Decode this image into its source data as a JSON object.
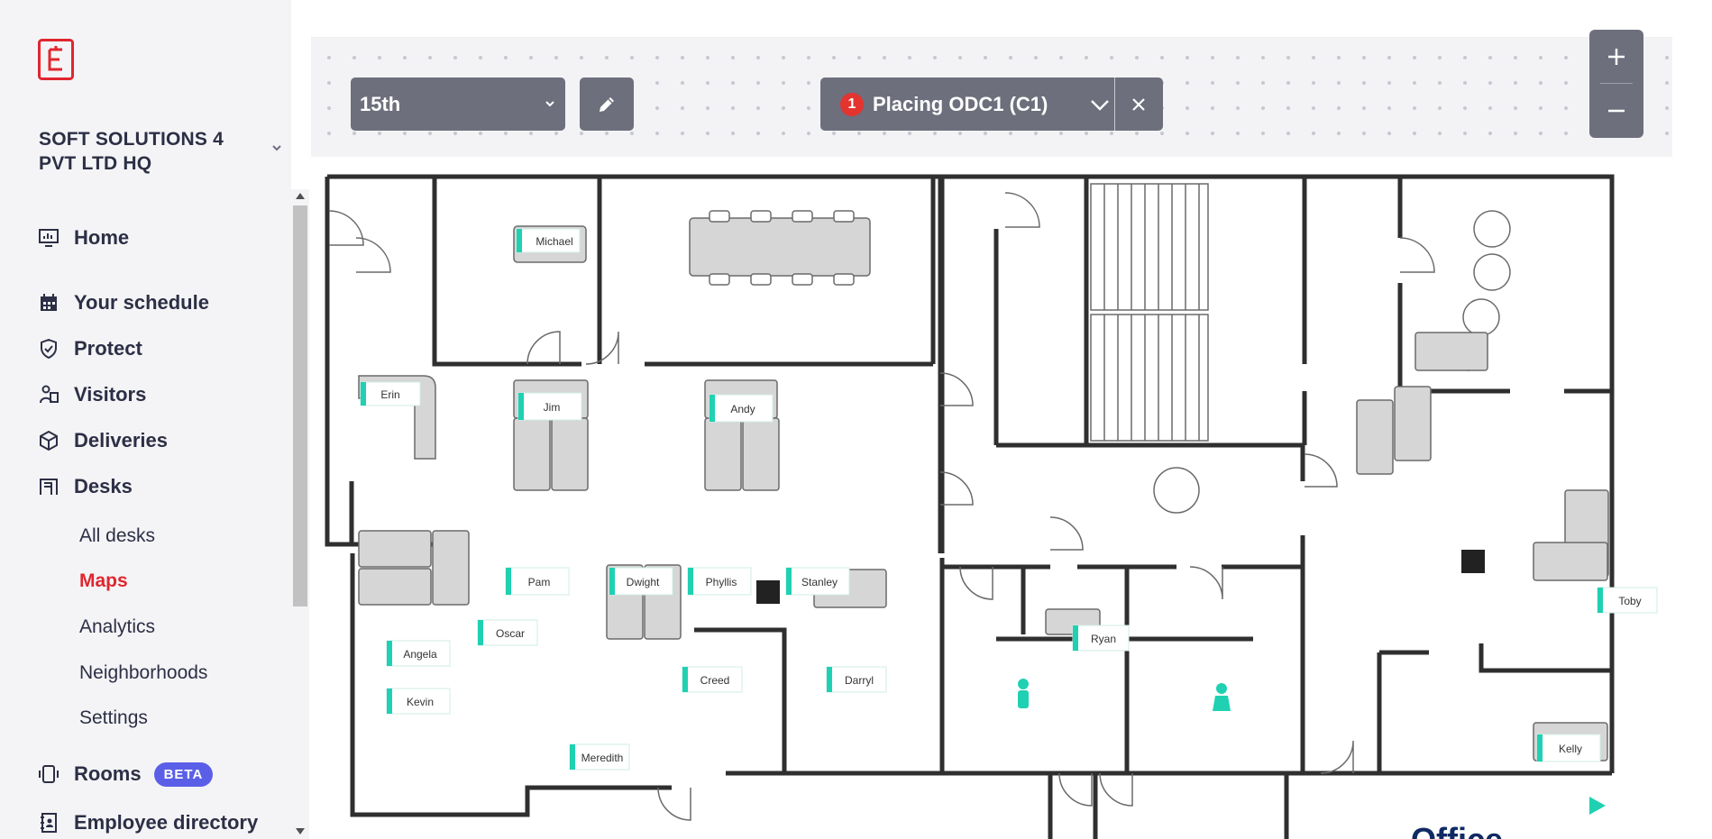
{
  "company": {
    "name": "SOFT SOLUTIONS 4 PVT LTD HQ"
  },
  "nav": {
    "home": "Home",
    "schedule": "Your schedule",
    "protect": "Protect",
    "visitors": "Visitors",
    "deliveries": "Deliveries",
    "desks": "Desks",
    "desks_sub": {
      "all_desks": "All desks",
      "maps": "Maps",
      "analytics": "Analytics",
      "neighborhoods": "Neighborhoods",
      "settings": "Settings"
    },
    "rooms": "Rooms",
    "rooms_badge": "BETA",
    "directory": "Employee directory"
  },
  "toolbar": {
    "floor": "15th",
    "placing_count": "1",
    "placing_label": "Placing ODC1 (C1)",
    "zoom_in": "+",
    "zoom_out": "–"
  },
  "map": {
    "desk_names": {
      "michael": "Michael",
      "erin": "Erin",
      "jim": "Jim",
      "andy": "Andy",
      "pam": "Pam",
      "dwight": "Dwight",
      "phyllis": "Phyllis",
      "stanley": "Stanley",
      "oscar": "Oscar",
      "angela": "Angela",
      "kevin": "Kevin",
      "creed": "Creed",
      "darryl": "Darryl",
      "meredith": "Meredith",
      "ryan": "Ryan",
      "toby": "Toby",
      "kelly": "Kelly"
    },
    "footer_brand_fragment": "Office"
  },
  "colors": {
    "accent": "#e0262f",
    "toolbar": "#6d6f7c",
    "badge": "#5b5fe8",
    "desk_tag": "#1fd1b2"
  }
}
